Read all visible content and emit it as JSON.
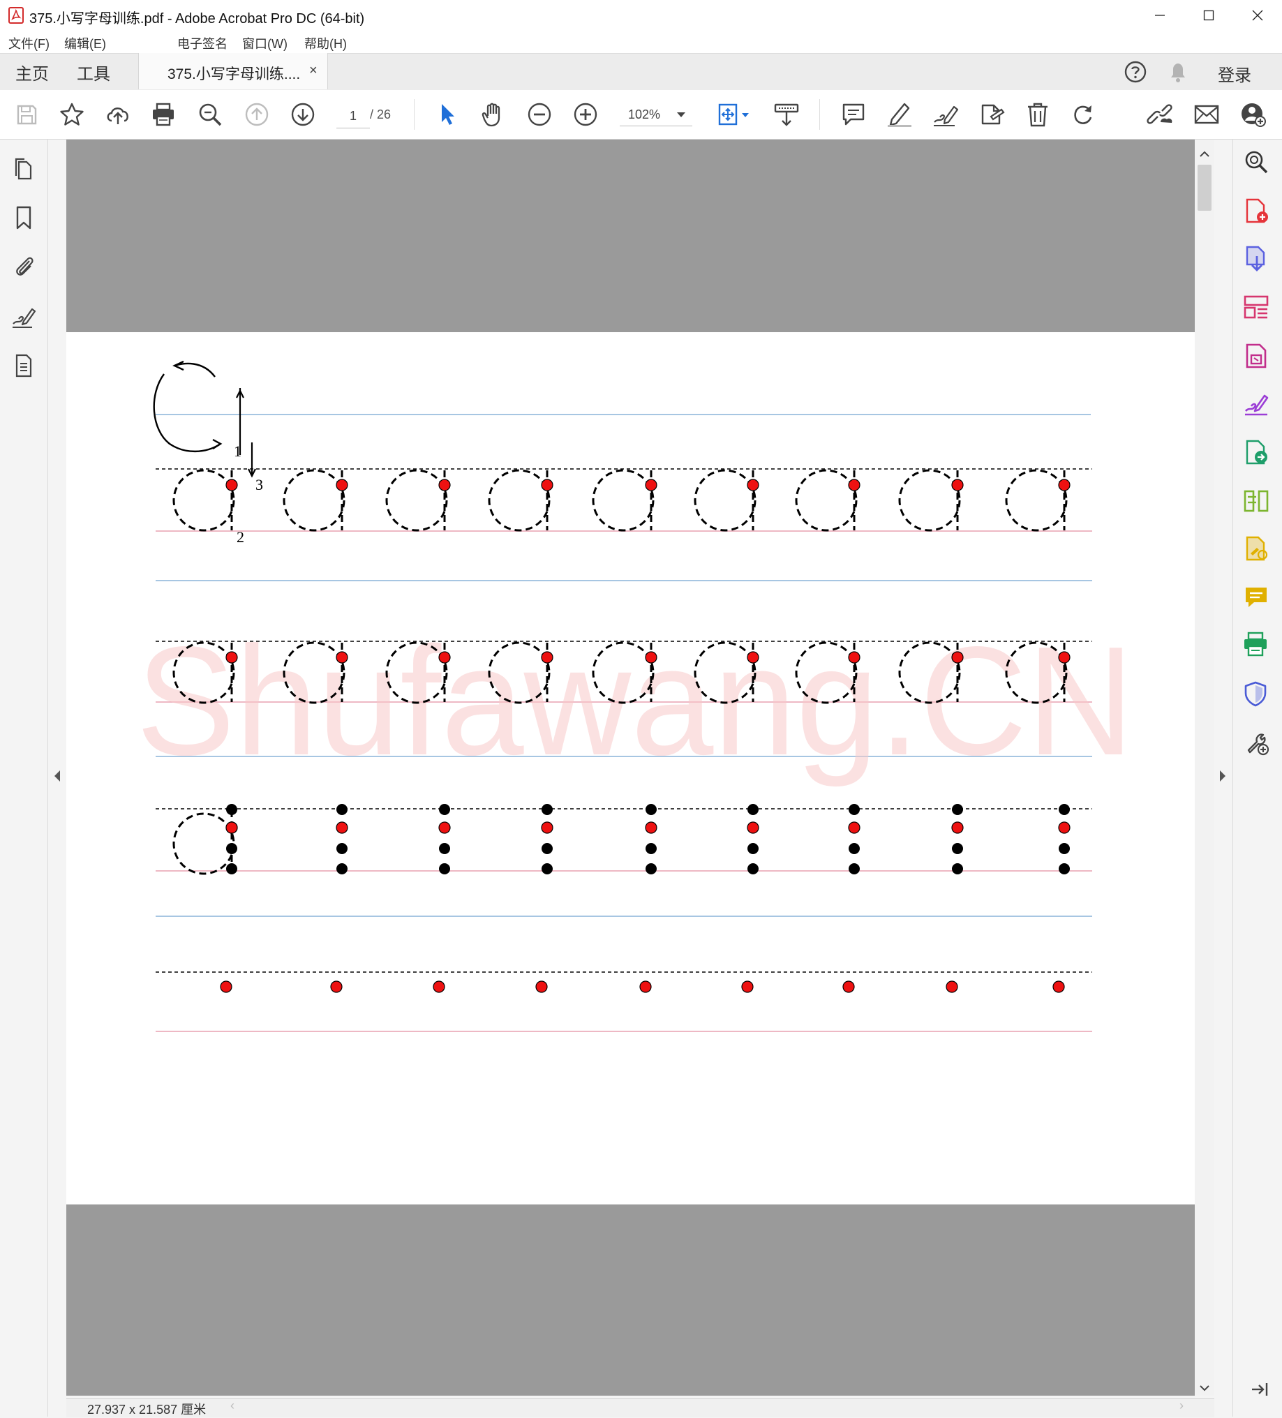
{
  "window": {
    "title": "375.小写字母训练.pdf - Adobe Acrobat Pro DC (64-bit)",
    "controls": [
      "minimize",
      "maximize",
      "close"
    ]
  },
  "menu": [
    "文件(F)",
    "编辑(E)",
    "电子签名",
    "窗口(W)",
    "帮助(H)"
  ],
  "nav": {
    "home": "主页",
    "tools": "工具",
    "doc_tab": "375.小写字母训练....",
    "tab_close": "×",
    "sign_in": "登录"
  },
  "toolbar": {
    "page_current": "1",
    "page_total": "/ 26",
    "zoom": "102%",
    "icons": [
      "save-icon",
      "bookmark-star-icon",
      "cloud-upload-icon",
      "print-icon",
      "search-zoom-icon",
      "page-up-icon",
      "page-down-icon",
      "select-pointer-icon",
      "hand-icon",
      "zoom-out-icon",
      "zoom-in-icon",
      "zoom-dropdown-icon",
      "fit-page-icon",
      "scroll-mode-icon",
      "comment-icon",
      "highlight-icon",
      "sign-icon",
      "stamp-icon",
      "delete-icon",
      "rotate-icon",
      "link-icon",
      "email-icon",
      "share-user-icon"
    ]
  },
  "left_panel": [
    "page-thumbnails-icon",
    "bookmarks-icon",
    "attachments-icon",
    "signatures-icon",
    "document-properties-icon"
  ],
  "right_panel": [
    {
      "icon": "enhance-scan-icon",
      "color": "#333333"
    },
    {
      "icon": "create-pdf-icon",
      "color": "#e5343a"
    },
    {
      "icon": "export-pdf-icon",
      "color": "#5b61e0"
    },
    {
      "icon": "organize-pages-icon",
      "color": "#d6366e"
    },
    {
      "icon": "edit-pdf-icon",
      "color": "#c12d8b"
    },
    {
      "icon": "fill-sign-icon",
      "color": "#9b3dd6"
    },
    {
      "icon": "send-for-signature-icon",
      "color": "#1e9e6a"
    },
    {
      "icon": "compare-icon",
      "color": "#7cb52f"
    },
    {
      "icon": "request-signature-icon",
      "color": "#e0b000"
    },
    {
      "icon": "comment-tool-icon",
      "color": "#e0b000"
    },
    {
      "icon": "print-production-icon",
      "color": "#1ea05a"
    },
    {
      "icon": "protect-icon",
      "color": "#4a5bd6"
    },
    {
      "icon": "more-tools-icon",
      "color": "#444444"
    }
  ],
  "document": {
    "watermark": "Shufawang.CN",
    "stroke_numbers": [
      "1",
      "2",
      "3"
    ],
    "letter": "a",
    "rows": 4,
    "columns": 9
  },
  "status": {
    "page_size": "27.937 x 21.587 厘米"
  },
  "colors": {
    "blue_line": "#8ab4d8",
    "red_line": "#e8a0b0",
    "dot_red": "#ee1111",
    "page_gray": "#9a9a9a"
  }
}
